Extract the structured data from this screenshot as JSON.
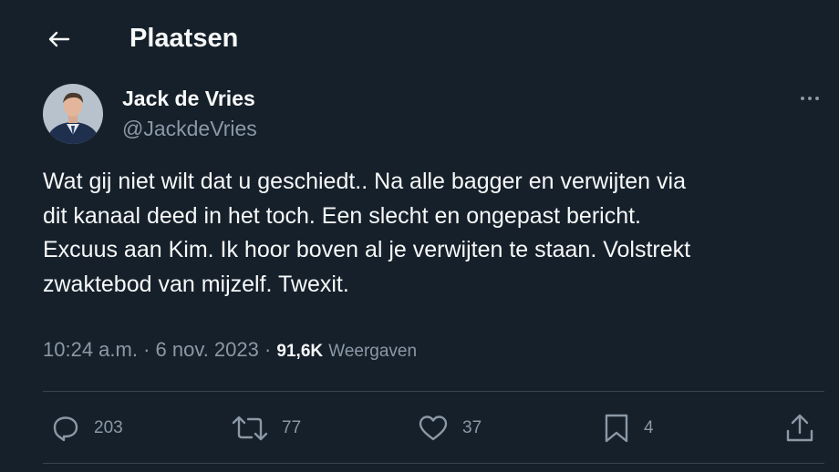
{
  "header": {
    "title": "Plaatsen"
  },
  "tweet": {
    "author_name": "Jack de Vries",
    "author_handle": "@JackdeVries",
    "text": "Wat gij niet wilt dat u geschiedt.. Na alle bagger en verwijten via\ndit kanaal deed in het toch. Een slecht en ongepast bericht.\nExcuus aan Kim. Ik hoor boven al je verwijten te staan. Volstrekt\nzwaktebod van mijzelf. Twexit.",
    "timestamp": "10:24 a.m. · 6 nov. 2023 · ",
    "views_count": "91,6K",
    "views_label": "Weergaven"
  },
  "actions": {
    "reply_count": "203",
    "retweet_count": "77",
    "like_count": "37",
    "bookmark_count": "4"
  },
  "colors": {
    "background": "#15202b",
    "text_primary": "#f7f9f9",
    "text_secondary": "#8b98a5",
    "divider": "#38444d"
  },
  "icons": [
    "back-arrow-icon",
    "more-icon",
    "reply-icon",
    "retweet-icon",
    "like-icon",
    "bookmark-icon",
    "share-icon"
  ]
}
